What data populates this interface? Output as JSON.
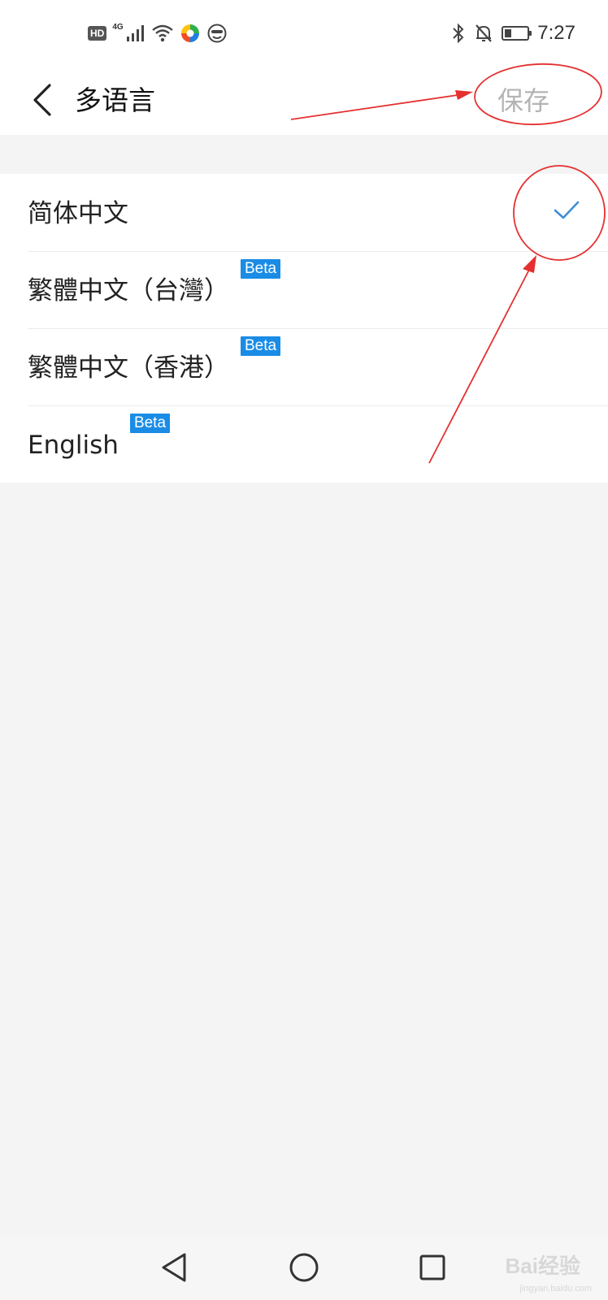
{
  "status_bar": {
    "hd": "HD",
    "network": "4G",
    "time": "7:27",
    "battery_level": 0.3,
    "icons": [
      "hd-badge",
      "signal-icon",
      "wifi-icon",
      "app-icon",
      "face-icon",
      "bluetooth-icon",
      "mute-bell-icon",
      "battery-icon"
    ]
  },
  "header": {
    "title": "多语言",
    "save_label": "保存",
    "back_icon": "chevron-left-icon"
  },
  "languages": [
    {
      "label": "简体中文",
      "beta": "",
      "selected": true
    },
    {
      "label": "繁體中文（台灣）",
      "beta": "Beta",
      "selected": false
    },
    {
      "label": "繁體中文（香港）",
      "beta": "Beta",
      "selected": false
    },
    {
      "label": "English",
      "beta": "Beta",
      "selected": false
    }
  ],
  "colors": {
    "accent": "#1a8ce6",
    "check": "#3f8fd6",
    "save_disabled": "#b4b4b4",
    "annotation": "#e53030"
  },
  "navbar": {
    "icons": [
      "back-triangle-icon",
      "home-circle-icon",
      "recents-square-icon"
    ]
  },
  "watermark": {
    "text": "Bai经验",
    "sub": "jingyan.baidu.com"
  }
}
